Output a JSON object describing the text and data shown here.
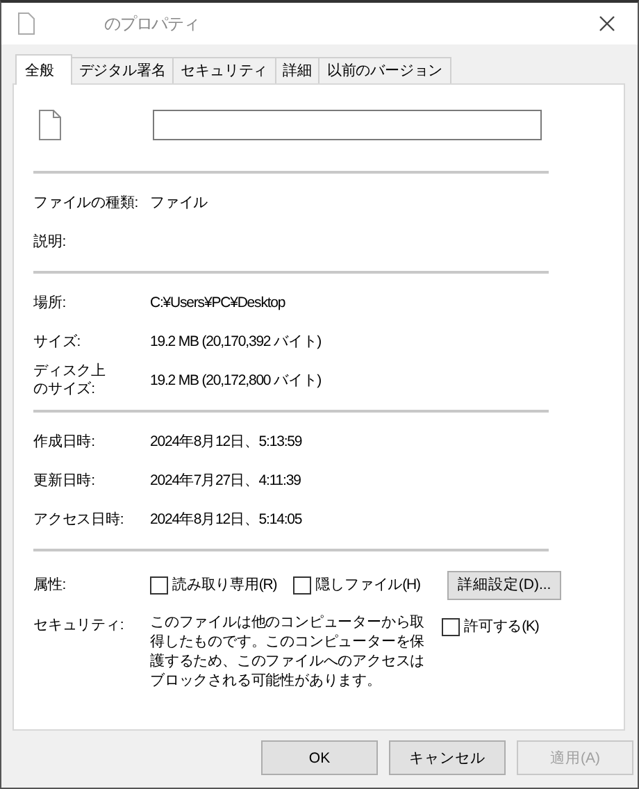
{
  "window": {
    "title": "のプロパティ"
  },
  "tabs": [
    {
      "label": "全般",
      "selected": true
    },
    {
      "label": "デジタル署名",
      "selected": false
    },
    {
      "label": "セキュリティ",
      "selected": false
    },
    {
      "label": "詳細",
      "selected": false
    },
    {
      "label": "以前のバージョン",
      "selected": false
    }
  ],
  "sections": [
    [
      {
        "label": "ファイルの種類:",
        "value": "ファイル"
      },
      {
        "label": "説明:"
      }
    ],
    [
      {
        "label": "場所:",
        "value": "C:¥Users¥PC¥Desktop"
      },
      {
        "label": "サイズ:",
        "value": "19.2 MB (20,170,392 バイト)"
      },
      {
        "label_lines": [
          "ディスク上",
          "のサイズ:"
        ],
        "value": "19.2 MB (20,172,800 バイト)"
      }
    ],
    [
      {
        "label": "作成日時:",
        "value": "2024年8月12日、5:13:59"
      },
      {
        "label": "更新日時:",
        "value": "2024年7月27日、4:11:39"
      },
      {
        "label": "アクセス日時:",
        "value": "2024年8月12日、5:14:05"
      }
    ]
  ],
  "attributes": {
    "label": "属性:",
    "checkboxes": [
      {
        "label": "読み取り専用(R)",
        "checked": false
      },
      {
        "label": "隠しファイル(H)",
        "checked": false
      }
    ],
    "advanced_button": "詳細設定(D)..."
  },
  "security": {
    "label": "セキュリティ:",
    "text": "このファイルは他のコンピューターから取得したものです。このコンピューターを保護するため、このファイルへのアクセスはブロックされる可能性があります。",
    "checkbox": {
      "label": "許可する(K)",
      "checked": false
    }
  },
  "buttons": [
    {
      "label": "OK",
      "disabled": false
    },
    {
      "label": "キャンセル",
      "disabled": false
    },
    {
      "label": "適用(A)",
      "disabled": true
    }
  ]
}
